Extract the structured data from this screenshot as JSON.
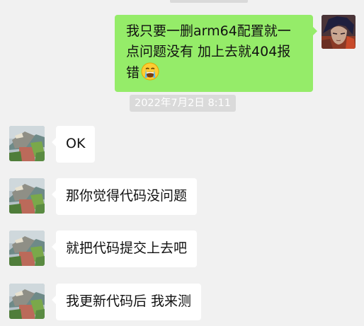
{
  "messages_out": [
    {
      "text": "我只要一删arm64配置就一点问题没有 加上去就404报错",
      "emoji": "crying-face-emoji"
    }
  ],
  "timestamp": "2022年7月2日 8:11",
  "messages_in": [
    {
      "text": "OK"
    },
    {
      "text": "那你觉得代码没问题"
    },
    {
      "text": "就把代码提交上去吧"
    },
    {
      "text": "我更新代码后 我来测"
    }
  ],
  "colors": {
    "background": "#f1f1f1",
    "outgoing_bubble": "#95ec69",
    "incoming_bubble": "#ffffff",
    "timestamp_bg": "#dadada",
    "timestamp_text": "#ffffff"
  }
}
